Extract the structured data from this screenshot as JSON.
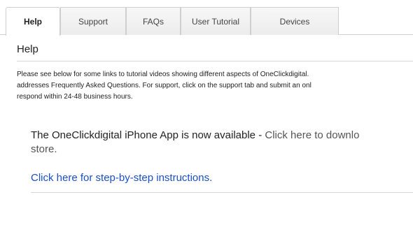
{
  "tabs": [
    {
      "label": "Help",
      "active": true
    },
    {
      "label": "Support",
      "active": false
    },
    {
      "label": "FAQs",
      "active": false
    },
    {
      "label": "User Tutorial",
      "active": false
    },
    {
      "label": "Devices",
      "active": false
    }
  ],
  "help": {
    "title": "Help",
    "intro_lines": [
      "Please see below for some links to tutorial videos showing different aspects of OneClickdigital.",
      "addresses Frequently Asked Questions. For support, click on the support tab and submit an onl",
      "respond within 24-48 business hours."
    ],
    "app_text": "The OneClickdigital iPhone App is now available - ",
    "app_link_line1": "Click here to downlo",
    "app_link_line2": "store.",
    "instructions_link": "Click here for step-by-step instructions."
  },
  "colors": {
    "link": "#1a4fc9",
    "muted_link": "#555555",
    "border": "#cfcfcf"
  }
}
